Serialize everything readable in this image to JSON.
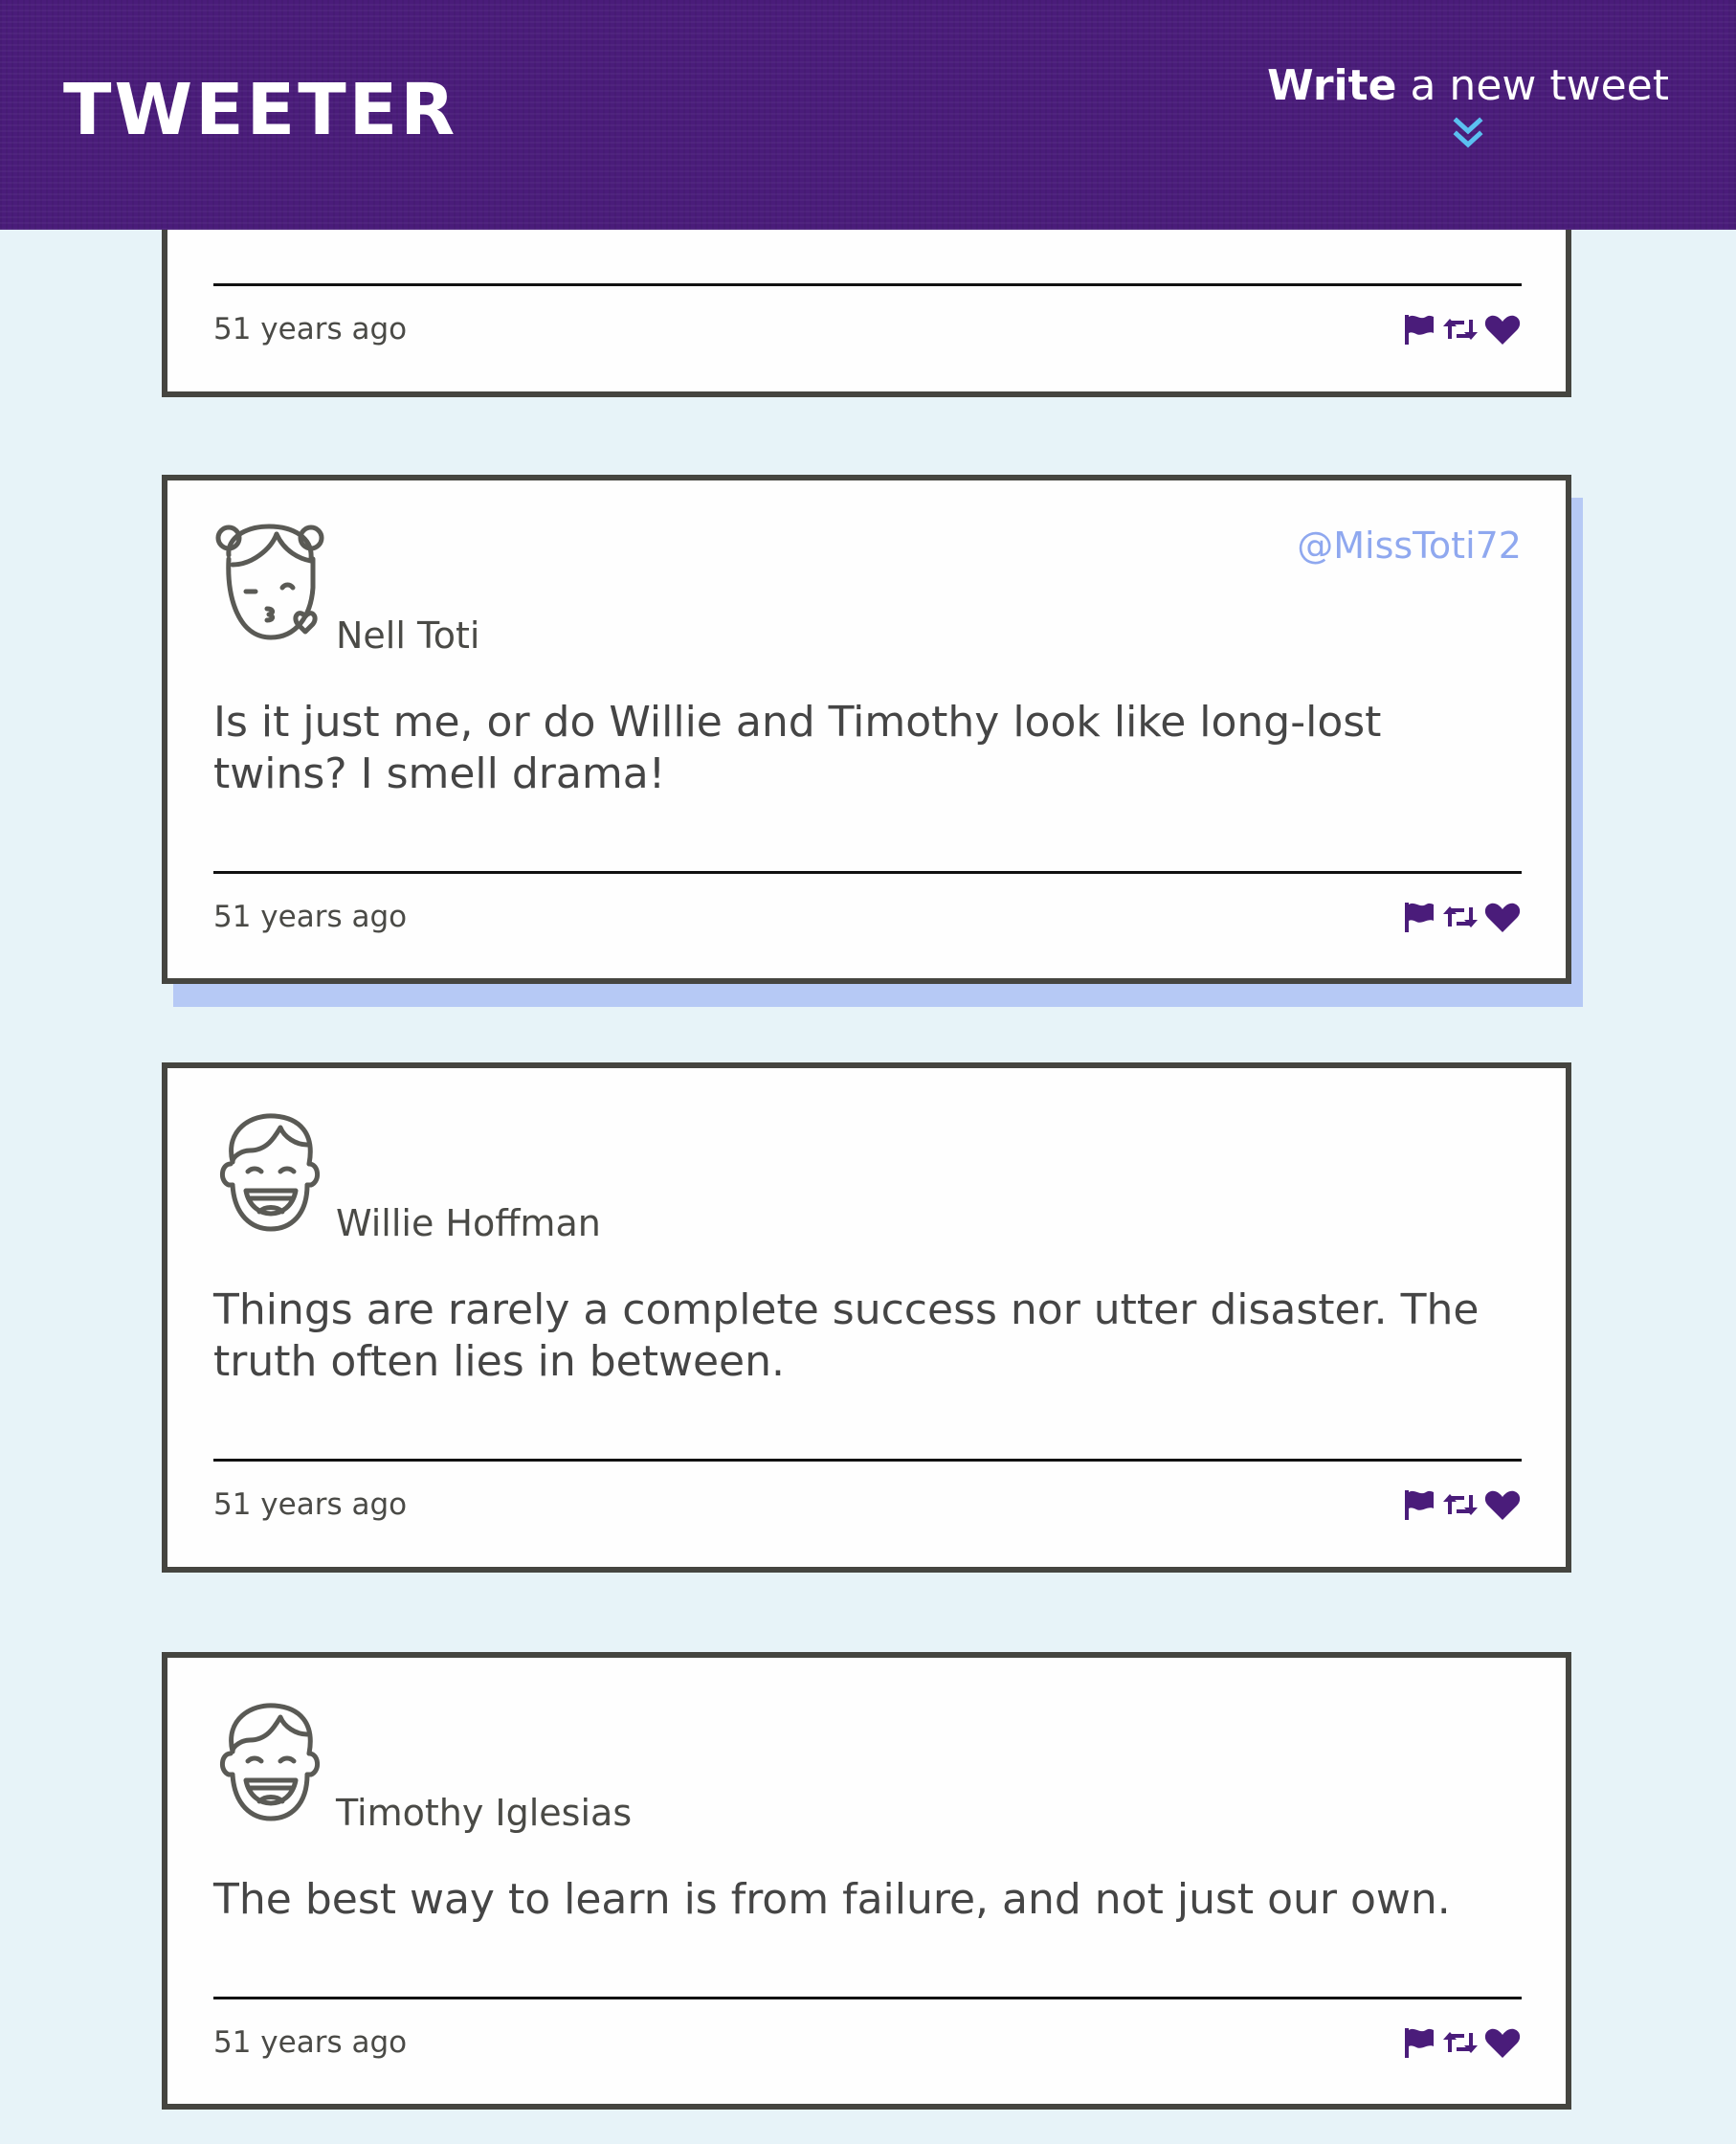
{
  "header": {
    "logo": "TWEETER",
    "compose_bold": "Write",
    "compose_rest": " a new tweet",
    "compose_icon": "chevron-double-down-icon"
  },
  "colors": {
    "nav": "#4a1c7a",
    "background": "#e7f3f8",
    "accent": "#4a1c7a",
    "chevron": "#5bc0f0",
    "handle": "#8fa8ef",
    "hover_shadow": "#b6c9f5"
  },
  "tweets": [
    {
      "timestamp": "51 years ago",
      "actions": [
        "flag-icon",
        "retweet-icon",
        "heart-icon"
      ]
    },
    {
      "name": "Nell Toti",
      "handle": "@MissToti72",
      "avatar": "girl-kiss-avatar",
      "text": "Is it just me, or do Willie and Timothy look like long-lost twins? I smell drama!",
      "timestamp": "51 years ago",
      "actions": [
        "flag-icon",
        "retweet-icon",
        "heart-icon"
      ]
    },
    {
      "name": "Willie Hoffman",
      "avatar": "boy-laughing-avatar",
      "text": "Things are rarely a complete success nor utter disaster. The truth often lies in between.",
      "timestamp": "51 years ago",
      "actions": [
        "flag-icon",
        "retweet-icon",
        "heart-icon"
      ]
    },
    {
      "name": "Timothy Iglesias",
      "avatar": "boy-laughing-avatar",
      "text": "The best way to learn is from failure, and not just our own.",
      "timestamp": "51 years ago",
      "actions": [
        "flag-icon",
        "retweet-icon",
        "heart-icon"
      ]
    }
  ]
}
